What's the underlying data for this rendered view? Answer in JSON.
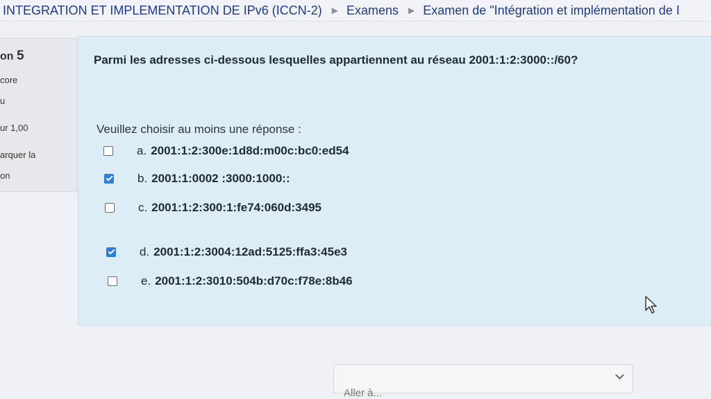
{
  "breadcrumb": {
    "course": "INTEGRATION ET IMPLEMENTATION DE IPv6 (ICCN-2)",
    "section": "Examens",
    "exam": "Examen de \"Intégration et implémentation de I"
  },
  "question_info": {
    "prefix": "on",
    "number": "5",
    "line1": "core",
    "line2": "u",
    "points": "ur 1,00",
    "flag1": "arquer la",
    "flag2": "on"
  },
  "question": {
    "text": "Parmi les adresses ci-dessous lesquelles appartiennent au réseau 2001:1:2:3000::/60?",
    "prompt": "Veuillez choisir au moins une réponse :",
    "answers": [
      {
        "letter": "a.",
        "address": "2001:1:2:300e:1d8d:m00c:bc0:ed54",
        "checked": false
      },
      {
        "letter": "b.",
        "address": "2001:1:0002 :3000:1000::",
        "checked": true
      },
      {
        "letter": "c.",
        "address": "2001:1:2:300:1:fe74:060d:3495",
        "checked": false
      },
      {
        "letter": "d.",
        "address": "2001:1:2:3004:12ad:5125:ffa3:45e3",
        "checked": true
      },
      {
        "letter": "e.",
        "address": "2001:1:2:3010:504b:d70c:f78e:8b46",
        "checked": false
      }
    ]
  },
  "jump_menu": {
    "label": "Aller à..."
  },
  "icons": {
    "breadcrumb_separator": "triangle-right-icon",
    "dropdown": "chevron-down-icon",
    "cursor": "mouse-pointer-icon"
  },
  "colors": {
    "question_bg": "#dcedf5",
    "checkbox_checked": "#2d7ddb",
    "breadcrumb_link": "#1d3a8a"
  }
}
